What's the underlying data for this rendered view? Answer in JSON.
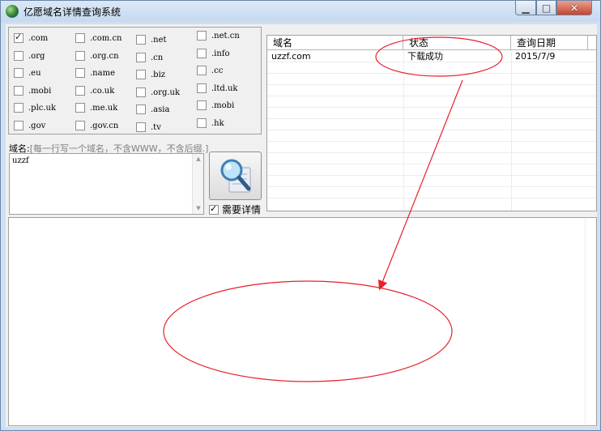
{
  "window": {
    "title": "亿愿域名详情查询系统",
    "icon": "globe-icon",
    "controls": {
      "minimize": "▁",
      "maximize": "□",
      "close": "✕"
    }
  },
  "tlds": [
    {
      "label": ".com",
      "checked": true
    },
    {
      "label": ".com.cn",
      "checked": false
    },
    {
      "label": ".net",
      "checked": false
    },
    {
      "label": ".net.cn",
      "checked": false
    },
    {
      "label": ".org",
      "checked": false
    },
    {
      "label": ".org.cn",
      "checked": false
    },
    {
      "label": ".cn",
      "checked": false
    },
    {
      "label": ".info",
      "checked": false
    },
    {
      "label": ".eu",
      "checked": false
    },
    {
      "label": ".name",
      "checked": false
    },
    {
      "label": ".biz",
      "checked": false
    },
    {
      "label": ".cc",
      "checked": false
    },
    {
      "label": ".mobi",
      "checked": false
    },
    {
      "label": ".co.uk",
      "checked": false
    },
    {
      "label": ".org.uk",
      "checked": false
    },
    {
      "label": ".ltd.uk",
      "checked": false
    },
    {
      "label": ".plc.uk",
      "checked": false
    },
    {
      "label": ".me.uk",
      "checked": false
    },
    {
      "label": ".asia",
      "checked": false
    },
    {
      "label": ".mobi",
      "checked": false
    },
    {
      "label": ".gov",
      "checked": false
    },
    {
      "label": ".gov.cn",
      "checked": false
    },
    {
      "label": ".tv",
      "checked": false
    },
    {
      "label": ".hk",
      "checked": false
    }
  ],
  "domain_input": {
    "label": "域名:",
    "hint": "[每一行写一个域名，不含WWW，不含后缀.]",
    "value": "uzzf"
  },
  "query_button": {
    "icon": "magnifier-icon"
  },
  "need_detail": {
    "label": "需要详情",
    "checked": true
  },
  "results": {
    "columns": [
      "域名",
      "状态",
      "查询日期"
    ],
    "rows": [
      {
        "domain": "uzzf.com",
        "status": "下载成功",
        "date": "2015/7/9"
      }
    ]
  },
  "annotation_color": "#e8202a"
}
